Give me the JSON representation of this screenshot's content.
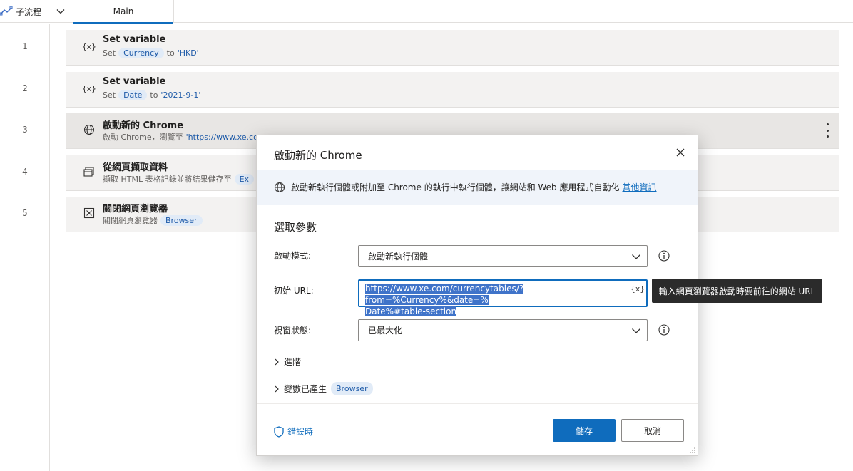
{
  "tabs": {
    "subflow_label": "子流程",
    "main_label": "Main"
  },
  "actions": [
    {
      "line": "1",
      "icon": "{x}",
      "title": "Set variable",
      "desc_prefix": "Set",
      "var": "Currency",
      "desc_mid": "to",
      "value": "'HKD'"
    },
    {
      "line": "2",
      "icon": "{x}",
      "title": "Set variable",
      "desc_prefix": "Set",
      "var": "Date",
      "desc_mid": "to",
      "value": "'2021-9-1'"
    },
    {
      "line": "3",
      "title": "啟動新的 Chrome",
      "desc_prefix": "啟動 Chrome，瀏覽至",
      "link": "'https://www.xe.co"
    },
    {
      "line": "4",
      "title": "從網頁擷取資料",
      "desc_prefix": "擷取 HTML 表格記錄並將結果儲存至",
      "var": "Ex"
    },
    {
      "line": "5",
      "title": "關閉網頁瀏覽器",
      "desc_prefix": "關閉網頁瀏覽器",
      "var": "Browser"
    }
  ],
  "dialog": {
    "title": "啟動新的 Chrome",
    "info_text": "啟動新執行個體或附加至 Chrome 的執行中執行個體，讓網站和 Web 應用程式自動化",
    "info_link": "其他資訊",
    "section_title": "選取參數",
    "launch_mode_label": "啟動模式:",
    "launch_mode_value": "啟動新執行個體",
    "url_label": "初始 URL:",
    "url_value_line1": "https://www.xe.com/currencytables/?from=%Currency%&date=%",
    "url_value_line2": "Date%#table-section",
    "url_var_button": "{x}",
    "window_state_label": "視窗狀態:",
    "window_state_value": "已最大化",
    "advanced_label": "進階",
    "vars_produced_label": "變數已產生",
    "vars_produced_tag": "Browser",
    "on_error_label": "錯誤時",
    "save_label": "儲存",
    "cancel_label": "取消"
  },
  "tooltip": "輸入網頁瀏覽器啟動時要前往的網站 URL",
  "colors": {
    "accent": "#0f6cbd",
    "tag_bg": "#e1ebf7",
    "tooltip_bg": "#2b2b2b"
  }
}
